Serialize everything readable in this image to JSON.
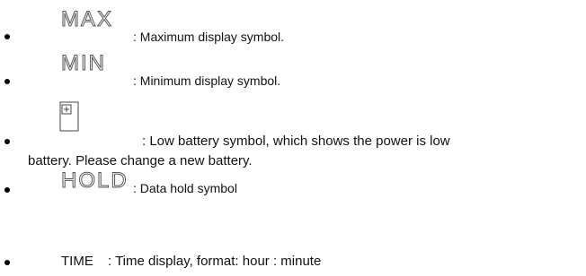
{
  "items": [
    {
      "symbol": "MAX",
      "description": ": Maximum display symbol."
    },
    {
      "symbol": "MIN",
      "description": ": Minimum display symbol."
    },
    {
      "symbol_icon": "battery-icon",
      "description_line1": ":  Low battery symbol, which shows the power is low",
      "description_line2": "battery. Please change a new battery."
    },
    {
      "symbol": "HOLD",
      "description": ": Data hold symbol"
    },
    {
      "label": "TIME",
      "description": ": Time display, format: hour : minute"
    }
  ],
  "colors": {
    "text": "#111111",
    "symbol_outline": "#555555",
    "background": "#ffffff"
  }
}
